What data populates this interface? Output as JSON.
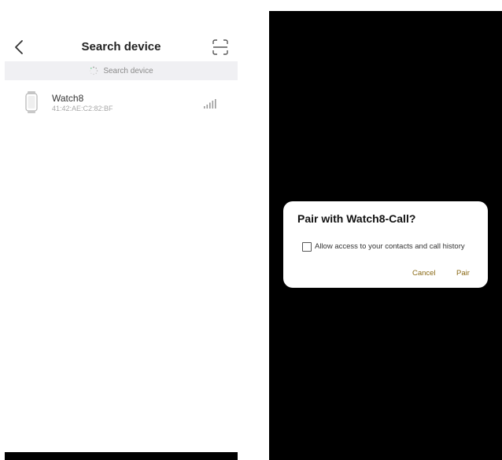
{
  "left_screen": {
    "header": {
      "title": "Search device",
      "back_icon": "chevron-left-icon",
      "scan_icon": "scan-frame-icon"
    },
    "search_banner": {
      "text": "Search device",
      "icon": "spinner-icon"
    },
    "devices": [
      {
        "name": "Watch8",
        "mac": "41:42:AE:C2:82:BF",
        "device_icon": "watch-icon",
        "signal_icon": "signal-strength-icon"
      }
    ]
  },
  "right_screen": {
    "dialog": {
      "title": "Pair with Watch8-Call?",
      "checkbox_label": "Allow access to your contacts and call history",
      "checkbox_checked": false,
      "cancel_label": "Cancel",
      "pair_label": "Pair",
      "button_color": "#8a6a16"
    }
  },
  "colors": {
    "banner_bg": "#f0f0f3",
    "overlay_bg": "#000000"
  }
}
